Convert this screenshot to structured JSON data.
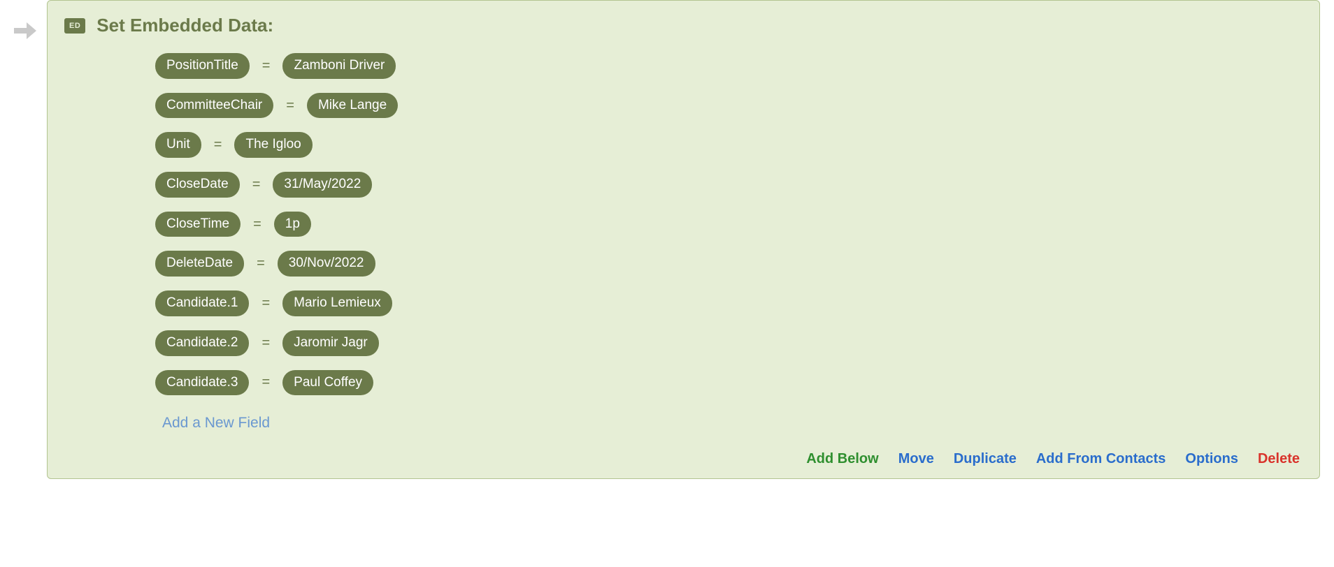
{
  "block": {
    "badge": "ED",
    "title": "Set Embedded Data:",
    "fields": [
      {
        "key": "PositionTitle",
        "value": "Zamboni Driver"
      },
      {
        "key": "CommitteeChair",
        "value": "Mike Lange"
      },
      {
        "key": "Unit",
        "value": "The Igloo"
      },
      {
        "key": "CloseDate",
        "value": "31/May/2022"
      },
      {
        "key": "CloseTime",
        "value": "1p"
      },
      {
        "key": "DeleteDate",
        "value": "30/Nov/2022"
      },
      {
        "key": "Candidate.1",
        "value": "Mario Lemieux"
      },
      {
        "key": "Candidate.2",
        "value": "Jaromir Jagr"
      },
      {
        "key": "Candidate.3",
        "value": "Paul Coffey"
      }
    ],
    "equals": "=",
    "add_field_label": "Add a New Field"
  },
  "footer": {
    "add_below": "Add Below",
    "move": "Move",
    "duplicate": "Duplicate",
    "add_from_contacts": "Add From Contacts",
    "options": "Options",
    "delete": "Delete"
  }
}
